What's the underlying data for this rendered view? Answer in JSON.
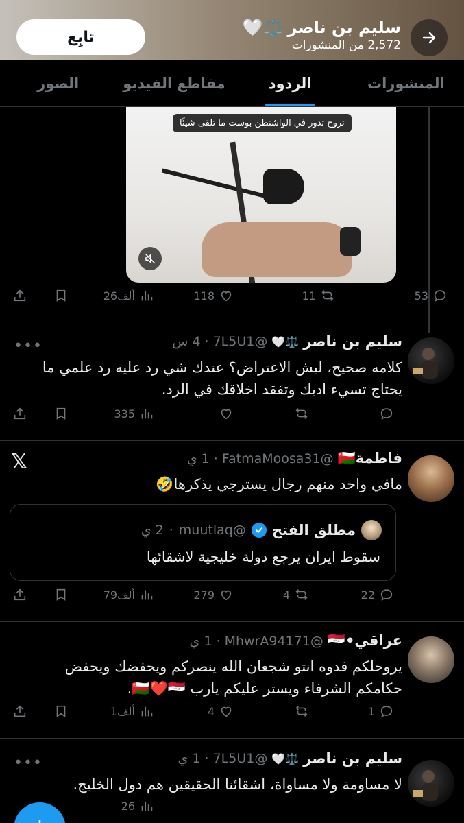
{
  "header": {
    "name": "سليم بن ناصر",
    "emoji": "⚖️🤍",
    "post_count": "2,572 من المنشورات",
    "follow_label": "تابِع"
  },
  "tabs": [
    {
      "label": "المنشورات",
      "active": false
    },
    {
      "label": "الردود",
      "active": true
    },
    {
      "label": "مقاطع الفيديو",
      "active": false
    },
    {
      "label": "الصور",
      "active": false
    }
  ],
  "video": {
    "caption": "تروح تدور في الواشنطن بوست ما تلقى شيئًا"
  },
  "first_actions": {
    "replies": "53",
    "reposts": "11",
    "likes": "118",
    "views": "26ألف"
  },
  "tweets": [
    {
      "name": "سليم بن ناصر",
      "emoji": "⚖️🤍",
      "handle": "@7L5U1",
      "time": "4 س",
      "text": "كلامه صحيح، ليش الاعتراض؟ عندك شي رد عليه رد علمي ما يحتاج تسيء ادبك وتفقد اخلاقك في الرد.",
      "replies": "",
      "reposts": "",
      "likes": "",
      "views": "335"
    },
    {
      "name": "فاطمة🇴🇲",
      "handle": "@FatmaMoosa31",
      "time": "1 ي",
      "text": "مافي واحد منهم رجال يسترجي يذكرها🤣",
      "replies": "22",
      "reposts": "4",
      "likes": "279",
      "views": "79ألف",
      "quote": {
        "name": "مطلق الفتح",
        "handle": "@muutlaq",
        "time": "2 ي",
        "text": "سقوط ايران يرجع دولة خليجية لاشقائها"
      }
    },
    {
      "name": "عراقي•🇮🇶",
      "handle": "@MhwrA94171",
      "time": "1 ي",
      "text": "يروحلكم فدوه انتو شجعان الله ينصركم ويحفضك ويحفض حكامكم الشرفاء ويستر عليكم يارب 🇴🇲❤️🇮🇶.",
      "replies": "1",
      "reposts": "",
      "likes": "4",
      "views": "1ألف"
    },
    {
      "name": "سليم بن ناصر",
      "emoji": "⚖️🤍",
      "handle": "@7L5U1",
      "time": "1 ي",
      "text": "لا مساومة ولا مساواة، اشقائنا الحقيقين هم دول الخليج.",
      "views": "26"
    }
  ],
  "more_dots": "•••",
  "x_logo": "𝕏",
  "fab_label": "+"
}
